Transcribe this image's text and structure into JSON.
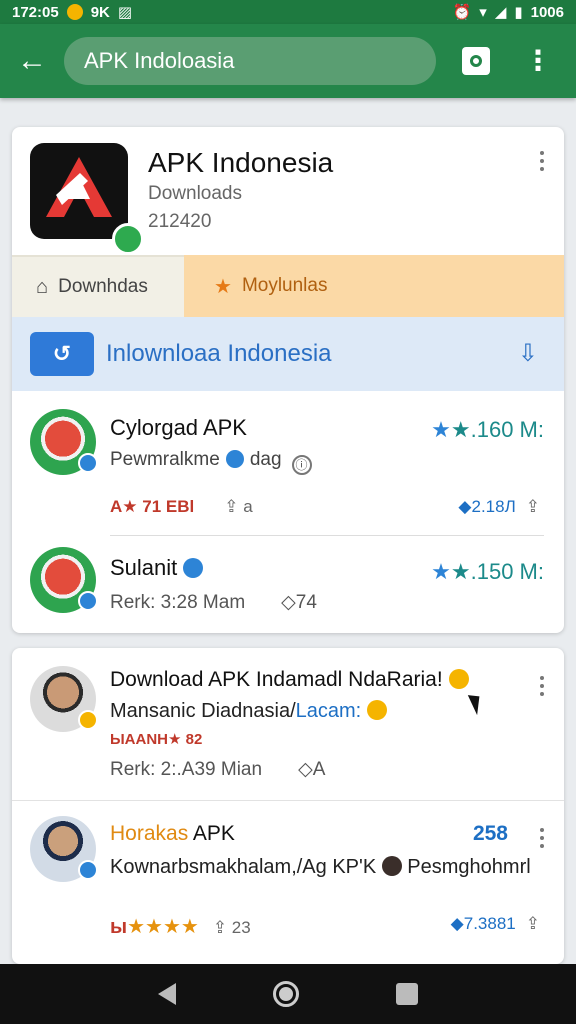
{
  "status": {
    "time": "172:05",
    "carrier": "9K",
    "battery": "1006"
  },
  "search": {
    "value": "APK Indoloasia"
  },
  "app": {
    "title": "APK Indonesia",
    "subtitle": "Downloads",
    "count": "212420"
  },
  "tabs": [
    {
      "label": "Downhdas"
    },
    {
      "label": "Moylunlas"
    }
  ],
  "promo": {
    "text": "Inlownloaa  Indonesia",
    "end_icon": "download-icon"
  },
  "rows": [
    {
      "title": "Cylorgad APK",
      "sub_a": "Pewmralkme",
      "sub_b": "dag",
      "rating": "★.160 M:",
      "meta_left": "A★ 71 EBl",
      "meta_right": "2.18Л",
      "share": "a"
    },
    {
      "title": "Sulanit",
      "date": "Rerk: 3:28 Mam",
      "count": "74",
      "rating": "★.150 M:"
    }
  ],
  "feed": [
    {
      "title": "Download APK Indamadl NdaRaria!",
      "sub_a": "Mansanic Diadnasia/",
      "sub_b": "Lacam:",
      "tag": "ЫAANH★ 82",
      "date": "Rerk: 2:.A39 Mian",
      "count": "A"
    },
    {
      "title_a": "Horakas",
      "title_b": "APK",
      "number": "258",
      "sub": "Kownarbsmakhalam,/Ag KP'K",
      "sub_end": "Pesmghohmrl",
      "stars_lead": "ы",
      "stars": "★★★★",
      "share_count": "23",
      "rating_right": "7.3881"
    }
  ],
  "colors": {
    "header": "#24864a",
    "accent_blue": "#2a6fc4",
    "tab_orange": "#fbd9a6"
  }
}
